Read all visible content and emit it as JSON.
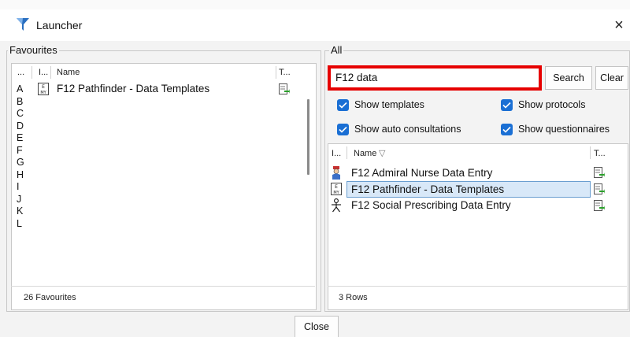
{
  "window": {
    "title": "Launcher",
    "close_glyph": "×",
    "icon": "launcher-funnel-icon"
  },
  "favourites": {
    "group_label": "Favourites",
    "columns": [
      "...",
      "I...",
      "Name",
      "T..."
    ],
    "letters": [
      "A",
      "B",
      "C",
      "D",
      "E",
      "F",
      "G",
      "H",
      "I",
      "J",
      "K",
      "L"
    ],
    "rows": [
      {
        "letter": "A",
        "icon": "template-icon",
        "name": "F12 Pathfinder - Data Templates",
        "type_icon": "template-launch-icon"
      }
    ],
    "status": "26 Favourites"
  },
  "all": {
    "group_label": "All",
    "search_value": "F12 data",
    "search_button": "Search",
    "clear_button": "Clear",
    "options": [
      {
        "label": "Show templates",
        "checked": true
      },
      {
        "label": "Show protocols",
        "checked": true
      },
      {
        "label": "Show auto consultations",
        "checked": true
      },
      {
        "label": "Show questionnaires",
        "checked": true
      }
    ],
    "columns": [
      "I...",
      "Name",
      "T..."
    ],
    "sort_glyph": "▽",
    "rows": [
      {
        "icon": "nurse-icon",
        "name": "F12 Admiral Nurse Data Entry",
        "type_icon": "template-launch-icon",
        "selected": false
      },
      {
        "icon": "template-icon",
        "name": "F12 Pathfinder - Data Templates",
        "type_icon": "template-launch-icon",
        "selected": true
      },
      {
        "icon": "person-icon",
        "name": "F12 Social Prescribing Data Entry",
        "type_icon": "template-launch-icon",
        "selected": false
      }
    ],
    "status": "3 Rows"
  },
  "footer": {
    "close_button": "Close"
  },
  "colors": {
    "accent": "#1a6fd4",
    "search_highlight": "#e60000",
    "selection": "#d8e8f8"
  }
}
